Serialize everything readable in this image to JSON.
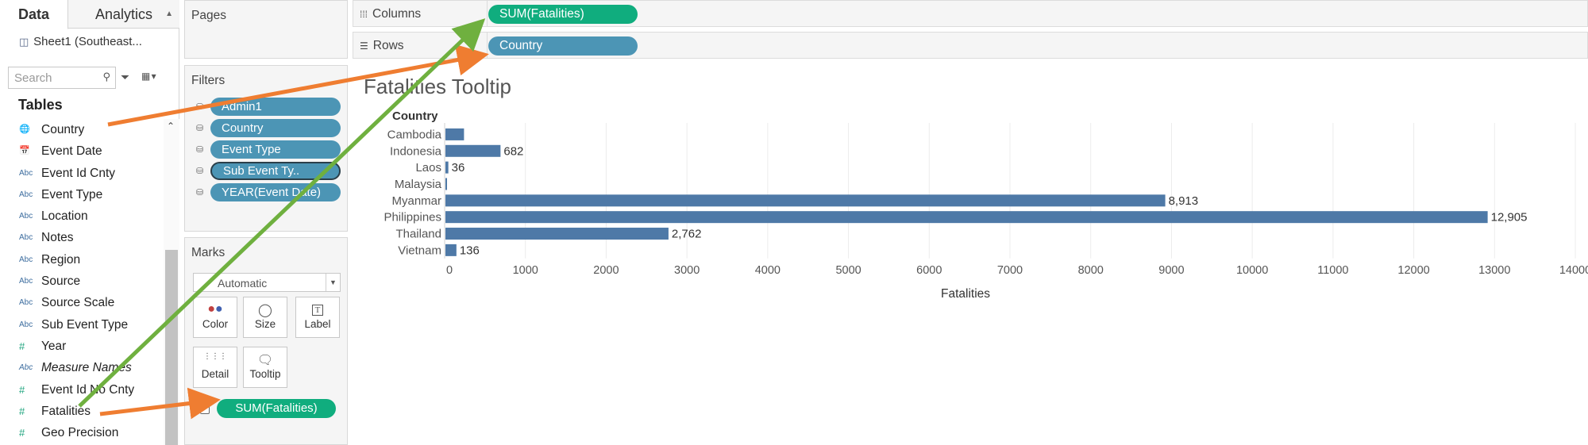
{
  "data_pane": {
    "tabs": [
      {
        "label": "Data"
      },
      {
        "label": "Analytics"
      }
    ],
    "datasource": "Sheet1 (Southeast...",
    "search_placeholder": "Search",
    "tables_title": "Tables",
    "fields": [
      {
        "label": "Country",
        "icon": "globe-icon",
        "type": "dimension"
      },
      {
        "label": "Event Date",
        "icon": "calendar-icon",
        "type": "dimension"
      },
      {
        "label": "Event Id Cnty",
        "icon": "Abc",
        "type": "dimension"
      },
      {
        "label": "Event Type",
        "icon": "Abc",
        "type": "dimension"
      },
      {
        "label": "Location",
        "icon": "Abc",
        "type": "dimension"
      },
      {
        "label": "Notes",
        "icon": "Abc",
        "type": "dimension"
      },
      {
        "label": "Region",
        "icon": "Abc",
        "type": "dimension"
      },
      {
        "label": "Source",
        "icon": "Abc",
        "type": "dimension"
      },
      {
        "label": "Source Scale",
        "icon": "Abc",
        "type": "dimension"
      },
      {
        "label": "Sub Event Type",
        "icon": "Abc",
        "type": "dimension"
      },
      {
        "label": "Year",
        "icon": "#",
        "type": "measure"
      },
      {
        "label": "Measure Names",
        "icon": "Abc",
        "type": "dimension",
        "italic": true
      },
      {
        "label": "Event Id No Cnty",
        "icon": "#",
        "type": "measure"
      },
      {
        "label": "Fatalities",
        "icon": "#",
        "type": "measure"
      },
      {
        "label": "Geo Precision",
        "icon": "#",
        "type": "measure"
      }
    ]
  },
  "pages_card": {
    "title": "Pages"
  },
  "filters_card": {
    "title": "Filters",
    "pills": [
      "Admin1",
      "Country",
      "Event Type",
      "Sub Event Ty..",
      "YEAR(Event Date)"
    ]
  },
  "marks_card": {
    "title": "Marks",
    "mark_type": "Automatic",
    "buttons": [
      {
        "label": "Color",
        "icon": "color-icon"
      },
      {
        "label": "Size",
        "icon": "size-icon"
      },
      {
        "label": "Label",
        "icon": "label-icon"
      },
      {
        "label": "Detail",
        "icon": "detail-icon"
      },
      {
        "label": "Tooltip",
        "icon": "tooltip-icon"
      }
    ],
    "tooltip_pill": "SUM(Fatalities)"
  },
  "columns_shelf": {
    "label": "Columns",
    "pill": "SUM(Fatalities)"
  },
  "rows_shelf": {
    "label": "Rows",
    "pill": "Country"
  },
  "view": {
    "title": "Fatalities Tooltip"
  },
  "colors": {
    "bar": "#4e79a7",
    "measure_pill": "#10ad7e",
    "dimension_pill": "#4c95b5",
    "arrow_orange": "#ef7d31",
    "arrow_green": "#6fb03f"
  },
  "chart_data": {
    "type": "bar",
    "orientation": "horizontal",
    "row_header": "Country",
    "categories": [
      "Cambodia",
      "Indonesia",
      "Laos",
      "Malaysia",
      "Myanmar",
      "Philippines",
      "Thailand",
      "Vietnam"
    ],
    "values": [
      230,
      682,
      36,
      12,
      8913,
      12905,
      2762,
      136
    ],
    "value_labels": [
      "",
      "682",
      "36",
      "",
      "8,913",
      "12,905",
      "2,762",
      "136"
    ],
    "xlabel": "Fatalities",
    "xlim": [
      0,
      14000
    ],
    "x_ticks": [
      "0",
      "1000",
      "2000",
      "3000",
      "4000",
      "5000",
      "6000",
      "7000",
      "8000",
      "9000",
      "10000",
      "11000",
      "12000",
      "13000",
      "14000"
    ],
    "grid": true
  }
}
